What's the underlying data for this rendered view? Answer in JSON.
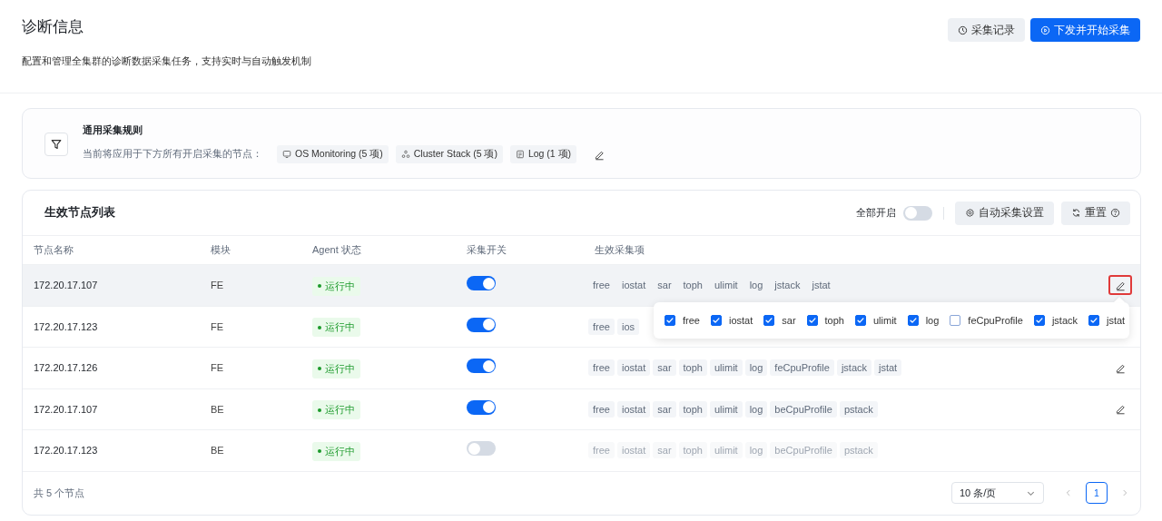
{
  "header": {
    "title": "诊断信息",
    "subtitle": "配置和管理全集群的诊断数据采集任务，支持实时与自动触发机制",
    "buttons": [
      {
        "label": "采集记录",
        "kind": "secondary"
      },
      {
        "label": "下发并开始采集",
        "kind": "primary"
      }
    ]
  },
  "rule_card": {
    "title": "通用采集规则",
    "description": "当前将应用于下方所有开启采集的节点：",
    "groups": [
      {
        "label": "OS Monitoring (5 项)",
        "kind": "os"
      },
      {
        "label": "Cluster Stack (5 项)",
        "kind": "cluster"
      },
      {
        "label": "Log (1 项)",
        "kind": "log"
      }
    ]
  },
  "node_list": {
    "title": "生效节点列表",
    "enable_all": {
      "label": "全部开启",
      "on": false
    },
    "buttons": [
      {
        "label": "自动采集设置",
        "kind": "settings"
      },
      {
        "label": "重置",
        "kind": "reset"
      }
    ],
    "columns": [
      "节点名称",
      "模块",
      "Agent 状态",
      "采集开关",
      "生效采集项"
    ],
    "rows": [
      {
        "node": "172.20.17.107",
        "module": "FE",
        "status": "运行中",
        "collect_on": true,
        "selected": true,
        "edit_button": true,
        "highlighted": true,
        "items": [
          "free",
          "iostat",
          "sar",
          "toph",
          "ulimit",
          "log",
          "jstack",
          "jstat"
        ]
      },
      {
        "node": "172.20.17.123",
        "module": "FE",
        "status": "运行中",
        "collect_on": true,
        "selected": false,
        "edit_button": false,
        "items": [
          "free",
          "ios"
        ]
      },
      {
        "node": "172.20.17.126",
        "module": "FE",
        "status": "运行中",
        "collect_on": true,
        "selected": false,
        "edit_button": true,
        "highlighted": false,
        "items": [
          "free",
          "iostat",
          "sar",
          "toph",
          "ulimit",
          "log",
          "feCpuProfile",
          "jstack",
          "jstat"
        ]
      },
      {
        "node": "172.20.17.107",
        "module": "BE",
        "status": "运行中",
        "collect_on": true,
        "selected": false,
        "edit_button": true,
        "highlighted": false,
        "items": [
          "free",
          "iostat",
          "sar",
          "toph",
          "ulimit",
          "log",
          "beCpuProfile",
          "pstack"
        ]
      },
      {
        "node": "172.20.17.123",
        "module": "BE",
        "status": "运行中",
        "collect_on": false,
        "selected": false,
        "edit_button": false,
        "items": [
          "free",
          "iostat",
          "sar",
          "toph",
          "ulimit",
          "log",
          "beCpuProfile",
          "pstack"
        ]
      }
    ],
    "popover": {
      "options": [
        {
          "label": "free",
          "checked": true
        },
        {
          "label": "iostat",
          "checked": true
        },
        {
          "label": "sar",
          "checked": true
        },
        {
          "label": "toph",
          "checked": true
        },
        {
          "label": "ulimit",
          "checked": true
        },
        {
          "label": "log",
          "checked": true
        },
        {
          "label": "feCpuProfile",
          "checked": false
        },
        {
          "label": "jstack",
          "checked": true
        },
        {
          "label": "jstat",
          "checked": true
        }
      ]
    },
    "footer": {
      "total": "共 5 个节点",
      "page_size": "10 条/页",
      "pages": [
        {
          "label": "1",
          "selected": true
        }
      ]
    }
  }
}
